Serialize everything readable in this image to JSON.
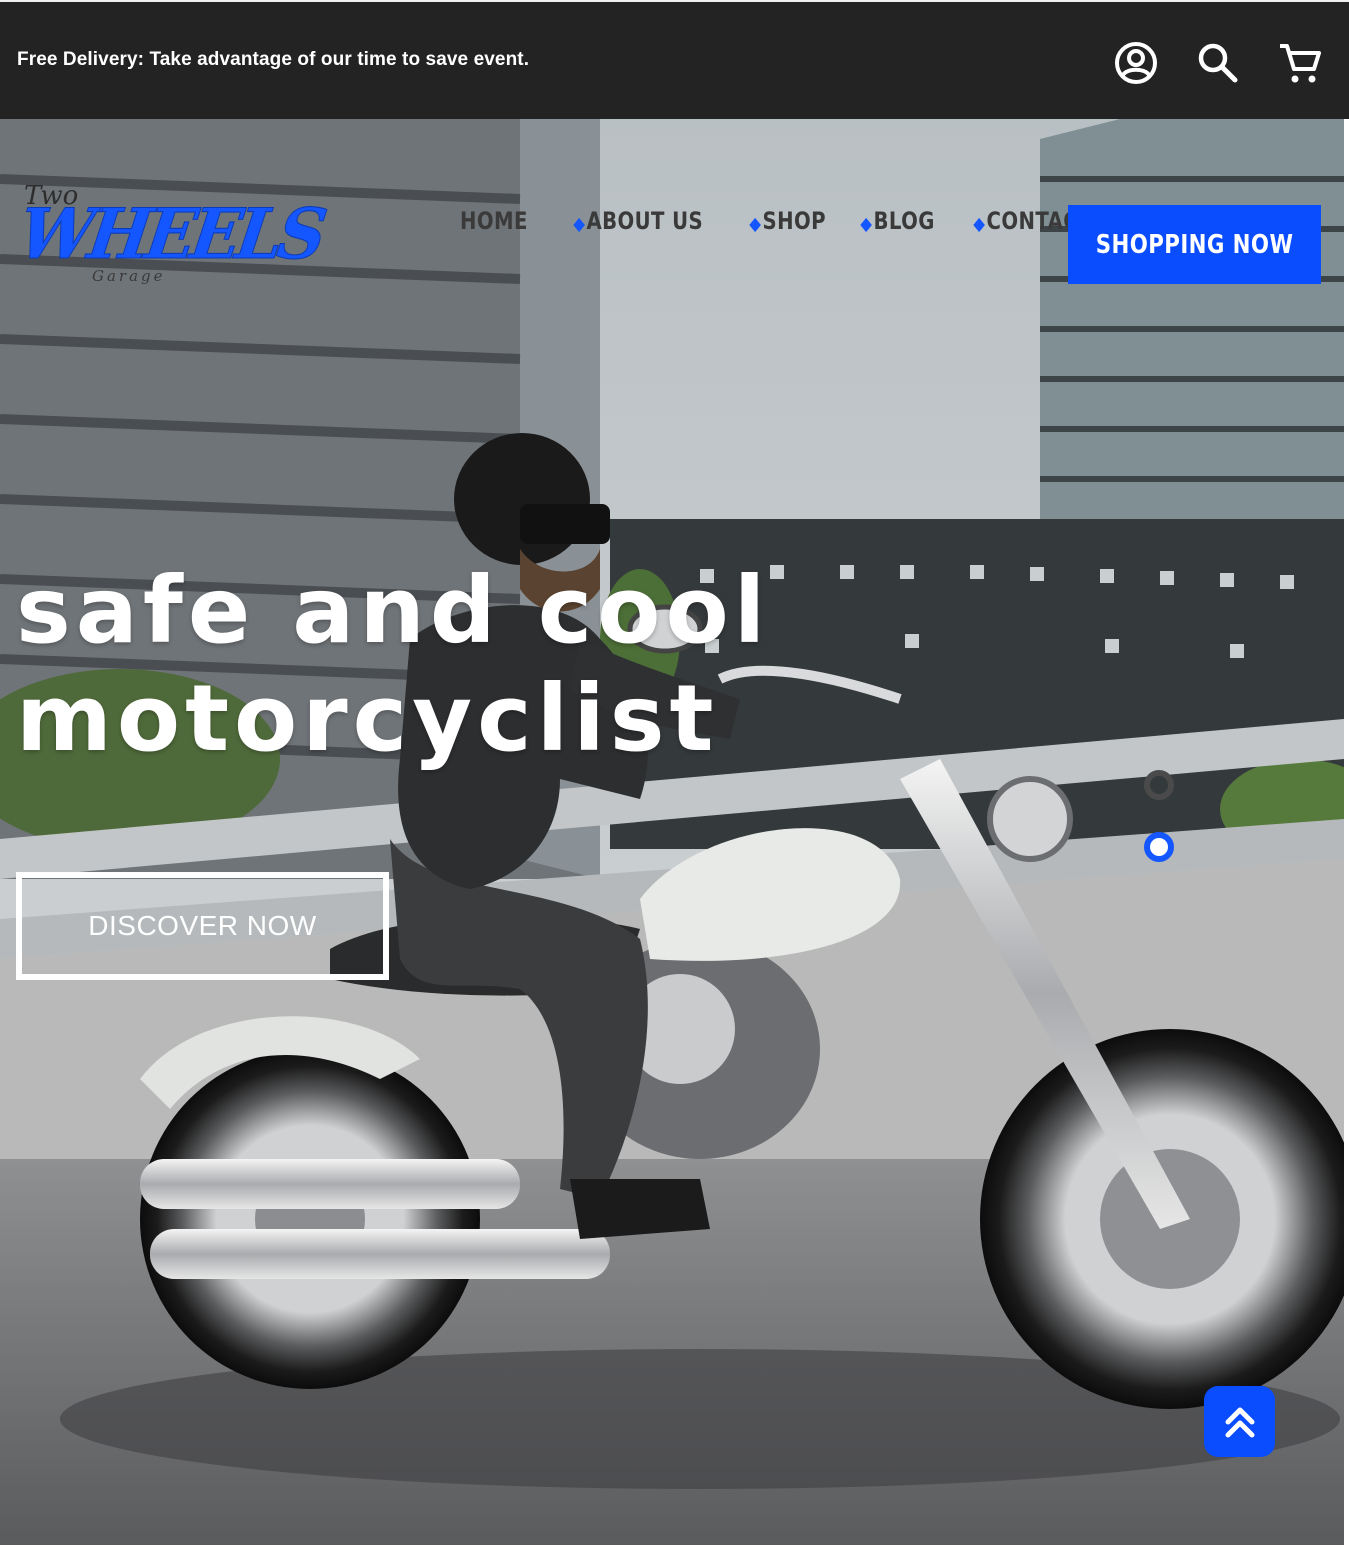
{
  "topbar": {
    "announcement": "Free Delivery: Take advantage of our time to save event.",
    "icons": [
      "account-icon",
      "search-icon",
      "cart-icon"
    ]
  },
  "logo": {
    "small": "Two",
    "main": "WHEELS",
    "sub": "Garage"
  },
  "nav": {
    "items": [
      {
        "label": "HOME"
      },
      {
        "label": "ABOUT US"
      },
      {
        "label": "SHOP"
      },
      {
        "label": "BLOG"
      },
      {
        "label": "CONTACT"
      }
    ],
    "separator_color": "#1456ff"
  },
  "header": {
    "cta_label": "SHOPPING NOW"
  },
  "hero": {
    "headline_line1": "safe and cool",
    "headline_line2": "motorcyclist",
    "button_label": "DISCOVER NOW",
    "slides_total": 2,
    "active_slide": 2
  },
  "colors": {
    "accent": "#0a4dff",
    "topbar_bg": "#232323",
    "nav_text": "#3a3a3a"
  }
}
